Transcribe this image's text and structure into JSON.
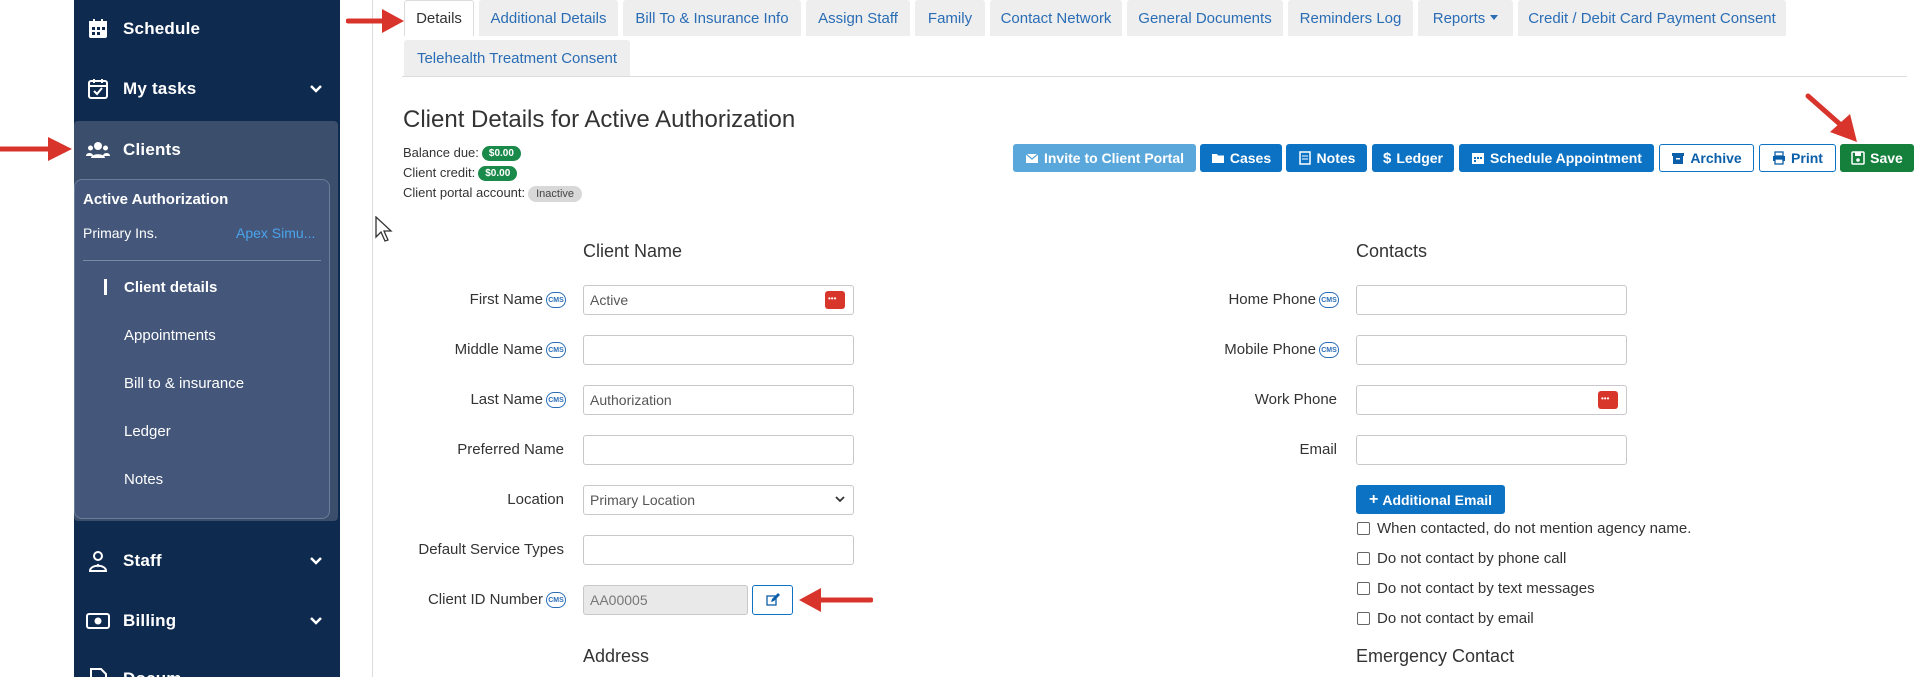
{
  "sidebar": {
    "schedule": "Schedule",
    "my_tasks": "My tasks",
    "clients": "Clients",
    "client_card": {
      "client_name": "Active Authorization",
      "primary_ins_label": "Primary Ins.",
      "primary_ins_value": "Apex Simu...",
      "links": [
        "Client details",
        "Appointments",
        "Bill to & insurance",
        "Ledger",
        "Notes"
      ],
      "active_link": "Client details"
    },
    "staff": "Staff",
    "billing": "Billing",
    "documents_partial": "Docum..."
  },
  "tabs": [
    {
      "label": "Details",
      "active": true
    },
    {
      "label": "Additional Details"
    },
    {
      "label": "Bill To & Insurance Info"
    },
    {
      "label": "Assign Staff"
    },
    {
      "label": "Family"
    },
    {
      "label": "Contact Network"
    },
    {
      "label": "General Documents"
    },
    {
      "label": "Reminders Log"
    },
    {
      "label": "Reports"
    },
    {
      "label": "Credit / Debit Card Payment Consent"
    },
    {
      "label": "Telehealth Treatment Consent"
    }
  ],
  "header": {
    "title": "Client Details for Active Authorization",
    "balance_label": "Balance due:",
    "balance_value": "$0.00",
    "credit_label": "Client credit:",
    "credit_value": "$0.00",
    "portal_label": "Client portal account:",
    "portal_status": "Inactive"
  },
  "actions": {
    "invite": "Invite to Client Portal",
    "cases": "Cases",
    "notes": "Notes",
    "ledger": "Ledger",
    "schedule": "Schedule Appointment",
    "archive": "Archive",
    "print": "Print",
    "save": "Save"
  },
  "client_name_section": {
    "heading": "Client Name",
    "cms": "CMS",
    "first_name_label": "First Name",
    "first_name_value": "Active",
    "middle_name_label": "Middle Name",
    "middle_name_value": "",
    "last_name_label": "Last Name",
    "last_name_value": "Authorization",
    "preferred_name_label": "Preferred Name",
    "preferred_name_value": "",
    "location_label": "Location",
    "location_value": "Primary Location",
    "service_types_label": "Default Service Types",
    "service_types_value": "",
    "client_id_label": "Client ID Number",
    "client_id_value": "AA00005"
  },
  "contacts_section": {
    "heading": "Contacts",
    "home_phone_label": "Home Phone",
    "mobile_phone_label": "Mobile Phone",
    "work_phone_label": "Work Phone",
    "email_label": "Email",
    "additional_email": "Additional Email",
    "checkboxes": [
      "When contacted, do not mention agency name.",
      "Do not contact by phone call",
      "Do not contact by text messages",
      "Do not contact by email"
    ]
  },
  "address_heading": "Address",
  "emergency_heading": "Emergency Contact",
  "colors": {
    "sidebar_bg": "#0e2a4f",
    "primary_blue": "#0b72c4",
    "save_green": "#14803c",
    "arrow_red": "#d9342b"
  }
}
